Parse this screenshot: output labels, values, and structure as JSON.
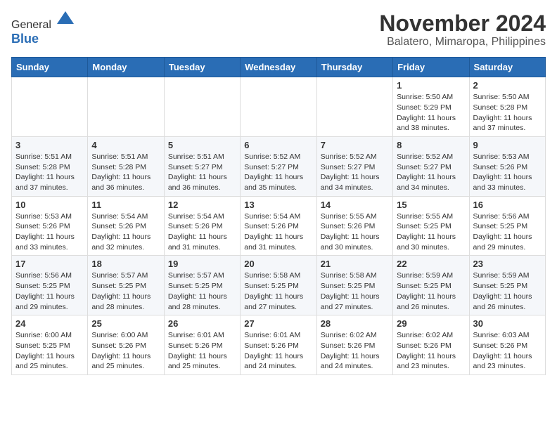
{
  "header": {
    "logo_line1": "General",
    "logo_line2": "Blue",
    "title": "November 2024",
    "subtitle": "Balatero, Mimaropa, Philippines"
  },
  "calendar": {
    "days_of_week": [
      "Sunday",
      "Monday",
      "Tuesday",
      "Wednesday",
      "Thursday",
      "Friday",
      "Saturday"
    ],
    "weeks": [
      [
        {
          "day": "",
          "info": ""
        },
        {
          "day": "",
          "info": ""
        },
        {
          "day": "",
          "info": ""
        },
        {
          "day": "",
          "info": ""
        },
        {
          "day": "",
          "info": ""
        },
        {
          "day": "1",
          "info": "Sunrise: 5:50 AM\nSunset: 5:29 PM\nDaylight: 11 hours and 38 minutes."
        },
        {
          "day": "2",
          "info": "Sunrise: 5:50 AM\nSunset: 5:28 PM\nDaylight: 11 hours and 37 minutes."
        }
      ],
      [
        {
          "day": "3",
          "info": "Sunrise: 5:51 AM\nSunset: 5:28 PM\nDaylight: 11 hours and 37 minutes."
        },
        {
          "day": "4",
          "info": "Sunrise: 5:51 AM\nSunset: 5:28 PM\nDaylight: 11 hours and 36 minutes."
        },
        {
          "day": "5",
          "info": "Sunrise: 5:51 AM\nSunset: 5:27 PM\nDaylight: 11 hours and 36 minutes."
        },
        {
          "day": "6",
          "info": "Sunrise: 5:52 AM\nSunset: 5:27 PM\nDaylight: 11 hours and 35 minutes."
        },
        {
          "day": "7",
          "info": "Sunrise: 5:52 AM\nSunset: 5:27 PM\nDaylight: 11 hours and 34 minutes."
        },
        {
          "day": "8",
          "info": "Sunrise: 5:52 AM\nSunset: 5:27 PM\nDaylight: 11 hours and 34 minutes."
        },
        {
          "day": "9",
          "info": "Sunrise: 5:53 AM\nSunset: 5:26 PM\nDaylight: 11 hours and 33 minutes."
        }
      ],
      [
        {
          "day": "10",
          "info": "Sunrise: 5:53 AM\nSunset: 5:26 PM\nDaylight: 11 hours and 33 minutes."
        },
        {
          "day": "11",
          "info": "Sunrise: 5:54 AM\nSunset: 5:26 PM\nDaylight: 11 hours and 32 minutes."
        },
        {
          "day": "12",
          "info": "Sunrise: 5:54 AM\nSunset: 5:26 PM\nDaylight: 11 hours and 31 minutes."
        },
        {
          "day": "13",
          "info": "Sunrise: 5:54 AM\nSunset: 5:26 PM\nDaylight: 11 hours and 31 minutes."
        },
        {
          "day": "14",
          "info": "Sunrise: 5:55 AM\nSunset: 5:26 PM\nDaylight: 11 hours and 30 minutes."
        },
        {
          "day": "15",
          "info": "Sunrise: 5:55 AM\nSunset: 5:25 PM\nDaylight: 11 hours and 30 minutes."
        },
        {
          "day": "16",
          "info": "Sunrise: 5:56 AM\nSunset: 5:25 PM\nDaylight: 11 hours and 29 minutes."
        }
      ],
      [
        {
          "day": "17",
          "info": "Sunrise: 5:56 AM\nSunset: 5:25 PM\nDaylight: 11 hours and 29 minutes."
        },
        {
          "day": "18",
          "info": "Sunrise: 5:57 AM\nSunset: 5:25 PM\nDaylight: 11 hours and 28 minutes."
        },
        {
          "day": "19",
          "info": "Sunrise: 5:57 AM\nSunset: 5:25 PM\nDaylight: 11 hours and 28 minutes."
        },
        {
          "day": "20",
          "info": "Sunrise: 5:58 AM\nSunset: 5:25 PM\nDaylight: 11 hours and 27 minutes."
        },
        {
          "day": "21",
          "info": "Sunrise: 5:58 AM\nSunset: 5:25 PM\nDaylight: 11 hours and 27 minutes."
        },
        {
          "day": "22",
          "info": "Sunrise: 5:59 AM\nSunset: 5:25 PM\nDaylight: 11 hours and 26 minutes."
        },
        {
          "day": "23",
          "info": "Sunrise: 5:59 AM\nSunset: 5:25 PM\nDaylight: 11 hours and 26 minutes."
        }
      ],
      [
        {
          "day": "24",
          "info": "Sunrise: 6:00 AM\nSunset: 5:25 PM\nDaylight: 11 hours and 25 minutes."
        },
        {
          "day": "25",
          "info": "Sunrise: 6:00 AM\nSunset: 5:26 PM\nDaylight: 11 hours and 25 minutes."
        },
        {
          "day": "26",
          "info": "Sunrise: 6:01 AM\nSunset: 5:26 PM\nDaylight: 11 hours and 25 minutes."
        },
        {
          "day": "27",
          "info": "Sunrise: 6:01 AM\nSunset: 5:26 PM\nDaylight: 11 hours and 24 minutes."
        },
        {
          "day": "28",
          "info": "Sunrise: 6:02 AM\nSunset: 5:26 PM\nDaylight: 11 hours and 24 minutes."
        },
        {
          "day": "29",
          "info": "Sunrise: 6:02 AM\nSunset: 5:26 PM\nDaylight: 11 hours and 23 minutes."
        },
        {
          "day": "30",
          "info": "Sunrise: 6:03 AM\nSunset: 5:26 PM\nDaylight: 11 hours and 23 minutes."
        }
      ]
    ]
  }
}
